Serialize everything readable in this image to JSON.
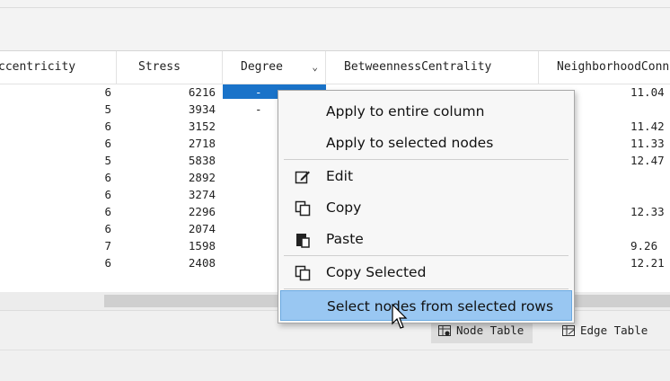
{
  "table": {
    "columns": [
      {
        "label": "ccentricity"
      },
      {
        "label": "Stress"
      },
      {
        "label": "Degree"
      },
      {
        "label": "BetweennessCentrality"
      },
      {
        "label": "NeighborhoodConn"
      }
    ],
    "sort_indicator": "⌄",
    "rows": [
      {
        "ecc": "6",
        "stress": "6216",
        "degree": "-",
        "nbr": "11.04"
      },
      {
        "ecc": "5",
        "stress": "3934",
        "degree": "-",
        "nbr": ""
      },
      {
        "ecc": "6",
        "stress": "3152",
        "degree": "",
        "nbr": "11.42"
      },
      {
        "ecc": "6",
        "stress": "2718",
        "degree": "",
        "nbr": "11.33"
      },
      {
        "ecc": "5",
        "stress": "5838",
        "degree": "",
        "nbr": "12.47"
      },
      {
        "ecc": "6",
        "stress": "2892",
        "degree": "",
        "nbr": ""
      },
      {
        "ecc": "6",
        "stress": "3274",
        "degree": "",
        "nbr": ""
      },
      {
        "ecc": "6",
        "stress": "2296",
        "degree": "",
        "nbr": "12.33"
      },
      {
        "ecc": "6",
        "stress": "2074",
        "degree": "",
        "nbr": ""
      },
      {
        "ecc": "7",
        "stress": "1598",
        "degree": "",
        "nbr": "9.26"
      },
      {
        "ecc": "6",
        "stress": "2408",
        "degree": "",
        "nbr": "12.21"
      }
    ]
  },
  "context_menu": {
    "items": [
      {
        "label": "Apply to entire column",
        "icon": ""
      },
      {
        "label": "Apply to selected nodes",
        "icon": ""
      },
      {
        "label": "Edit",
        "icon": "edit-icon"
      },
      {
        "label": "Copy",
        "icon": "copy-icon"
      },
      {
        "label": "Paste",
        "icon": "paste-icon"
      },
      {
        "label": "Copy Selected",
        "icon": "copy-icon"
      },
      {
        "label": "Select nodes from selected rows",
        "icon": ""
      }
    ]
  },
  "bottom_tabs": [
    {
      "label": "Node Table",
      "icon": "table-icon",
      "active": true
    },
    {
      "label": "Edge Table",
      "icon": "table-icon",
      "active": false
    }
  ],
  "colors": {
    "selection": "#1a73c9",
    "menu_highlight": "#99c7f2"
  }
}
